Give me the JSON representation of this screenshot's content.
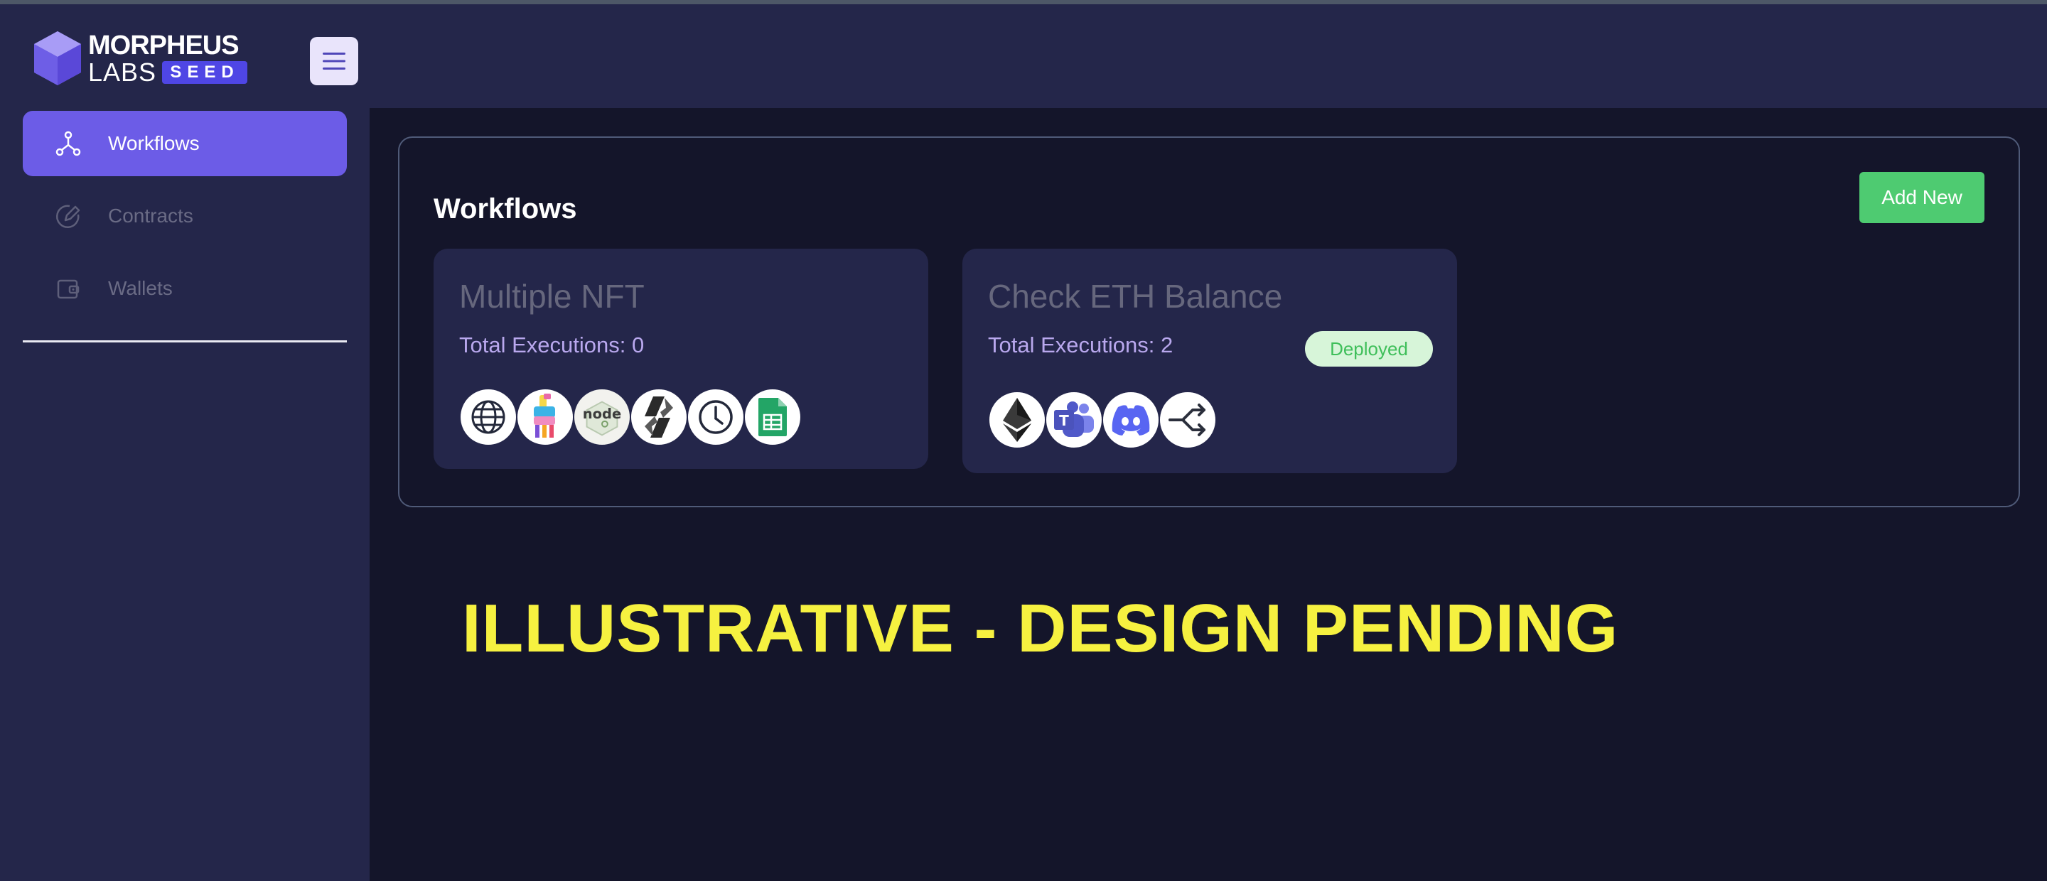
{
  "brand": {
    "name_line1": "MORPHEUS",
    "name_line2": "LABS",
    "badge": "SEED",
    "accent_color": "#6c5ce7"
  },
  "header": {
    "menu_icon": "hamburger-menu-icon"
  },
  "sidebar": {
    "items": [
      {
        "label": "Workflows",
        "icon": "workflow-nodes-icon",
        "active": true
      },
      {
        "label": "Contracts",
        "icon": "pencil-circle-icon",
        "active": false
      },
      {
        "label": "Wallets",
        "icon": "wallet-icon",
        "active": false
      }
    ]
  },
  "main": {
    "title": "Workflows",
    "add_button": "Add New",
    "add_button_color": "#4ecb71",
    "workflows": [
      {
        "name": "Multiple NFT",
        "executions": "Total Executions: 0",
        "status": "",
        "icons": [
          "globe-icon",
          "pinata-icon",
          "nodejs-icon",
          "chainlink-icon",
          "clock-icon",
          "google-sheets-icon"
        ]
      },
      {
        "name": "Check ETH Balance",
        "executions": "Total Executions: 2",
        "status": "Deployed",
        "icons": [
          "ethereum-icon",
          "microsoft-teams-icon",
          "discord-icon",
          "split-arrows-icon"
        ]
      }
    ]
  },
  "watermark": "ILLUSTRATIVE - DESIGN PENDING"
}
